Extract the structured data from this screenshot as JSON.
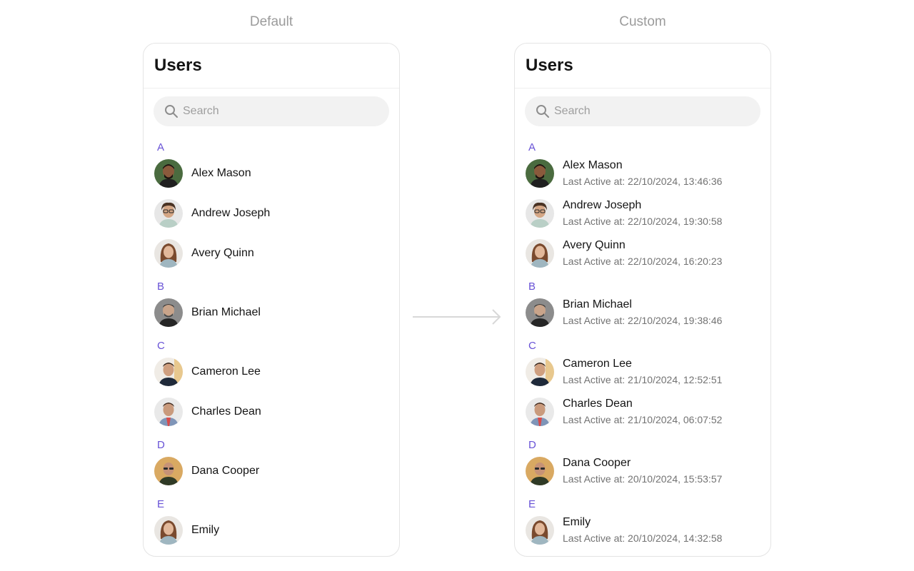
{
  "captions": {
    "default": "Default",
    "custom": "Custom"
  },
  "panels": {
    "default": {
      "title": "Users",
      "search_placeholder": "Search"
    },
    "custom": {
      "title": "Users",
      "search_placeholder": "Search"
    }
  },
  "sections": [
    "A",
    "B",
    "C",
    "D",
    "E"
  ],
  "users": [
    {
      "name": "Alex Mason",
      "last_active": "Last Active at: 22/10/2024, 13:46:36"
    },
    {
      "name": "Andrew Joseph",
      "last_active": "Last Active at: 22/10/2024, 19:30:58"
    },
    {
      "name": "Avery Quinn",
      "last_active": "Last Active at: 22/10/2024, 16:20:23"
    },
    {
      "name": "Brian Michael",
      "last_active": "Last Active at: 22/10/2024, 19:38:46"
    },
    {
      "name": "Cameron Lee",
      "last_active": "Last Active at: 21/10/2024, 12:52:51"
    },
    {
      "name": "Charles Dean",
      "last_active": "Last Active at: 21/10/2024, 06:07:52"
    },
    {
      "name": "Dana Cooper",
      "last_active": "Last Active at: 20/10/2024, 15:53:57"
    },
    {
      "name": "Emily",
      "last_active": "Last Active at: 20/10/2024, 14:32:58"
    }
  ],
  "colors": {
    "accent": "#6852d6",
    "border": "#e4e4e4",
    "search_bg": "#f2f2f2",
    "muted": "#727272"
  },
  "icons": {
    "search": "search-icon",
    "transition": "arrow-right-icon"
  }
}
